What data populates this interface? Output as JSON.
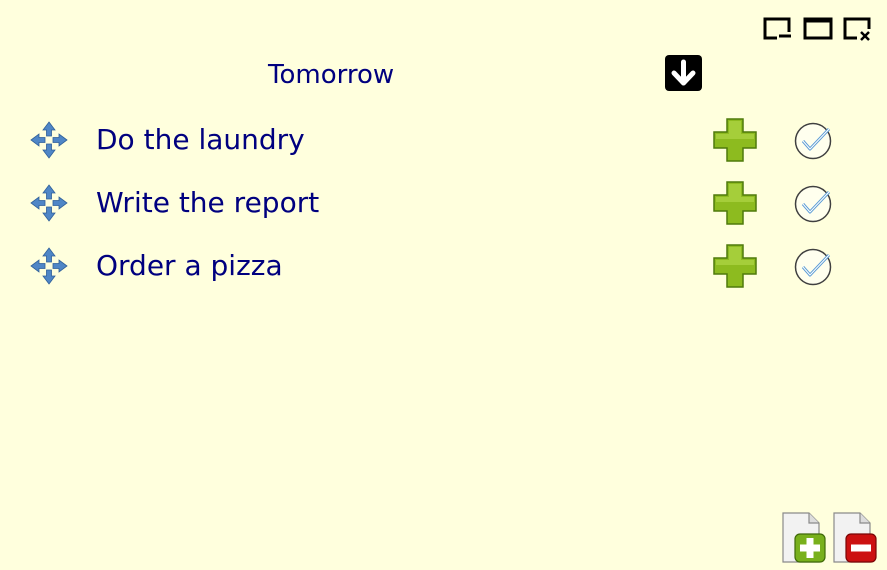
{
  "window": {
    "controls": [
      "restore-icon",
      "maximize-icon",
      "close-icon"
    ]
  },
  "list": {
    "title": "Tomorrow",
    "collapse_icon": "arrow-down-icon",
    "tasks": [
      {
        "label": "Do the laundry"
      },
      {
        "label": "Write the report"
      },
      {
        "label": "Order a pizza"
      }
    ]
  },
  "icons": {
    "drag": "move-arrows-icon",
    "add": "green-plus-icon",
    "done": "checkmark-circle-icon",
    "new_list": "new-document-icon",
    "delete_list": "delete-document-icon"
  },
  "colors": {
    "background": "#ffffdd",
    "text": "#00007f",
    "add_green": "#8dbb1f",
    "delete_red": "#cc1111",
    "move_blue": "#4f86c6"
  }
}
